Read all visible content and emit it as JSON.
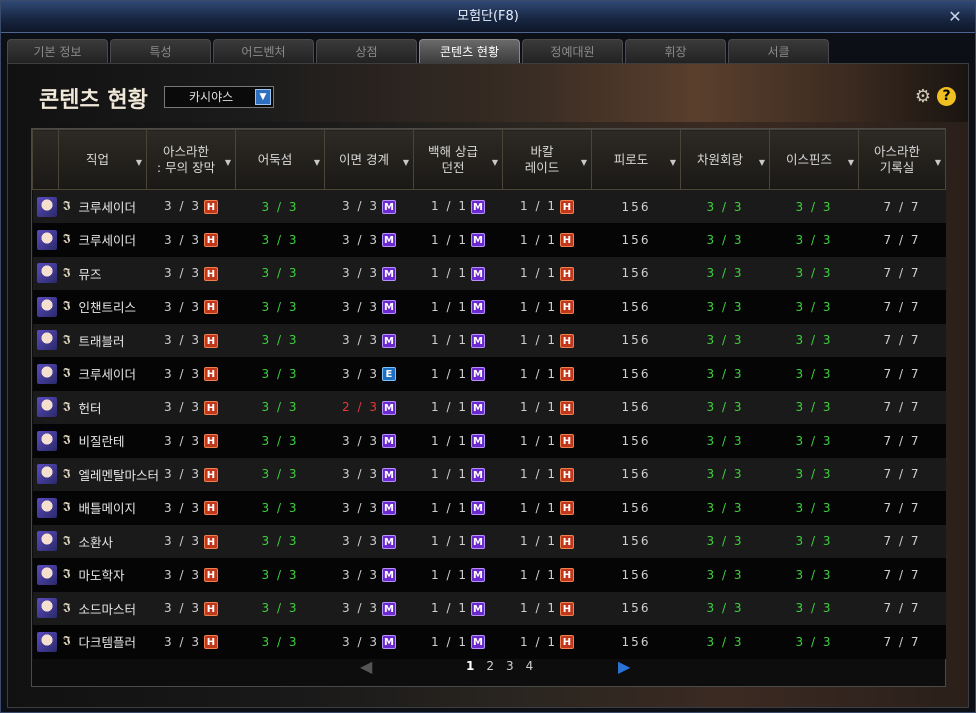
{
  "window": {
    "title": "모험단(F8)",
    "close": "✕"
  },
  "tabs": [
    {
      "label": "기본 정보",
      "active": false
    },
    {
      "label": "특성",
      "active": false
    },
    {
      "label": "어드벤처",
      "active": false
    },
    {
      "label": "상점",
      "active": false
    },
    {
      "label": "콘텐츠 현황",
      "active": true
    },
    {
      "label": "정예대원",
      "active": false
    },
    {
      "label": "휘장",
      "active": false
    },
    {
      "label": "서클",
      "active": false
    }
  ],
  "panel": {
    "heading": "콘텐츠 현황",
    "server": "카시야스",
    "server_arrow": "▼",
    "gear": "⚙",
    "help": "?"
  },
  "table": {
    "headers": [
      "직업",
      "아스라한 : 무의 장막",
      "어둑섬",
      "이면 경계",
      "백해 상급 던전",
      "바칼 레이드",
      "피로도",
      "차원회랑",
      "이스핀즈",
      "아스라한 기록실"
    ],
    "headers_lines": [
      [
        "직업"
      ],
      [
        "아스라한",
        ": 무의 장막"
      ],
      [
        "어둑섬"
      ],
      [
        "이면 경계"
      ],
      [
        "백해 상급",
        "던전"
      ],
      [
        "바칼",
        "레이드"
      ],
      [
        "피로도"
      ],
      [
        "차원회랑"
      ],
      [
        "이스핀즈"
      ],
      [
        "아스라한",
        "기록실"
      ]
    ],
    "sort_glyph": "▼",
    "guild_glyph": "𝕴",
    "rows": [
      {
        "job": "크루세이더",
        "asr": "3 / 3",
        "dark": "3 / 3",
        "bound": "3 / 3",
        "bound_badge": "M",
        "bound_red": false,
        "baek": "1 / 1",
        "bakal": "1 / 1",
        "fatigue": "156",
        "dim": "3 / 3",
        "ispins": "3 / 3",
        "record": "7 / 7"
      },
      {
        "job": "크루세이더",
        "asr": "3 / 3",
        "dark": "3 / 3",
        "bound": "3 / 3",
        "bound_badge": "M",
        "bound_red": false,
        "baek": "1 / 1",
        "bakal": "1 / 1",
        "fatigue": "156",
        "dim": "3 / 3",
        "ispins": "3 / 3",
        "record": "7 / 7"
      },
      {
        "job": "뮤즈",
        "asr": "3 / 3",
        "dark": "3 / 3",
        "bound": "3 / 3",
        "bound_badge": "M",
        "bound_red": false,
        "baek": "1 / 1",
        "bakal": "1 / 1",
        "fatigue": "156",
        "dim": "3 / 3",
        "ispins": "3 / 3",
        "record": "7 / 7"
      },
      {
        "job": "인챈트리스",
        "asr": "3 / 3",
        "dark": "3 / 3",
        "bound": "3 / 3",
        "bound_badge": "M",
        "bound_red": false,
        "baek": "1 / 1",
        "bakal": "1 / 1",
        "fatigue": "156",
        "dim": "3 / 3",
        "ispins": "3 / 3",
        "record": "7 / 7"
      },
      {
        "job": "트래블러",
        "asr": "3 / 3",
        "dark": "3 / 3",
        "bound": "3 / 3",
        "bound_badge": "M",
        "bound_red": false,
        "baek": "1 / 1",
        "bakal": "1 / 1",
        "fatigue": "156",
        "dim": "3 / 3",
        "ispins": "3 / 3",
        "record": "7 / 7"
      },
      {
        "job": "크루세이더",
        "asr": "3 / 3",
        "dark": "3 / 3",
        "bound": "3 / 3",
        "bound_badge": "E",
        "bound_red": false,
        "baek": "1 / 1",
        "bakal": "1 / 1",
        "fatigue": "156",
        "dim": "3 / 3",
        "ispins": "3 / 3",
        "record": "7 / 7"
      },
      {
        "job": "헌터",
        "asr": "3 / 3",
        "dark": "3 / 3",
        "bound": "2 / 3",
        "bound_badge": "M",
        "bound_red": true,
        "baek": "1 / 1",
        "bakal": "1 / 1",
        "fatigue": "156",
        "dim": "3 / 3",
        "ispins": "3 / 3",
        "record": "7 / 7"
      },
      {
        "job": "비질란테",
        "asr": "3 / 3",
        "dark": "3 / 3",
        "bound": "3 / 3",
        "bound_badge": "M",
        "bound_red": false,
        "baek": "1 / 1",
        "bakal": "1 / 1",
        "fatigue": "156",
        "dim": "3 / 3",
        "ispins": "3 / 3",
        "record": "7 / 7"
      },
      {
        "job": "엘레멘탈마스터",
        "asr": "3 / 3",
        "dark": "3 / 3",
        "bound": "3 / 3",
        "bound_badge": "M",
        "bound_red": false,
        "baek": "1 / 1",
        "bakal": "1 / 1",
        "fatigue": "156",
        "dim": "3 / 3",
        "ispins": "3 / 3",
        "record": "7 / 7"
      },
      {
        "job": "배틀메이지",
        "asr": "3 / 3",
        "dark": "3 / 3",
        "bound": "3 / 3",
        "bound_badge": "M",
        "bound_red": false,
        "baek": "1 / 1",
        "bakal": "1 / 1",
        "fatigue": "156",
        "dim": "3 / 3",
        "ispins": "3 / 3",
        "record": "7 / 7"
      },
      {
        "job": "소환사",
        "asr": "3 / 3",
        "dark": "3 / 3",
        "bound": "3 / 3",
        "bound_badge": "M",
        "bound_red": false,
        "baek": "1 / 1",
        "bakal": "1 / 1",
        "fatigue": "156",
        "dim": "3 / 3",
        "ispins": "3 / 3",
        "record": "7 / 7"
      },
      {
        "job": "마도학자",
        "asr": "3 / 3",
        "dark": "3 / 3",
        "bound": "3 / 3",
        "bound_badge": "M",
        "bound_red": false,
        "baek": "1 / 1",
        "bakal": "1 / 1",
        "fatigue": "156",
        "dim": "3 / 3",
        "ispins": "3 / 3",
        "record": "7 / 7"
      },
      {
        "job": "소드마스터",
        "asr": "3 / 3",
        "dark": "3 / 3",
        "bound": "3 / 3",
        "bound_badge": "M",
        "bound_red": false,
        "baek": "1 / 1",
        "bakal": "1 / 1",
        "fatigue": "156",
        "dim": "3 / 3",
        "ispins": "3 / 3",
        "record": "7 / 7"
      },
      {
        "job": "다크템플러",
        "asr": "3 / 3",
        "dark": "3 / 3",
        "bound": "3 / 3",
        "bound_badge": "M",
        "bound_red": false,
        "baek": "1 / 1",
        "bakal": "1 / 1",
        "fatigue": "156",
        "dim": "3 / 3",
        "ispins": "3 / 3",
        "record": "7 / 7"
      }
    ],
    "badges": {
      "asr": "H",
      "baek": "M",
      "bakal": "H"
    }
  },
  "pager": {
    "prev": "◀",
    "next": "▶",
    "pages": [
      "1",
      "2",
      "3",
      "4"
    ],
    "current": "1"
  },
  "colors": {
    "green": "#3dd13d",
    "red": "#e23a3a",
    "badge_H": "#c0371b",
    "badge_M": "#6a2ad0",
    "badge_E": "#1f6fc0"
  }
}
